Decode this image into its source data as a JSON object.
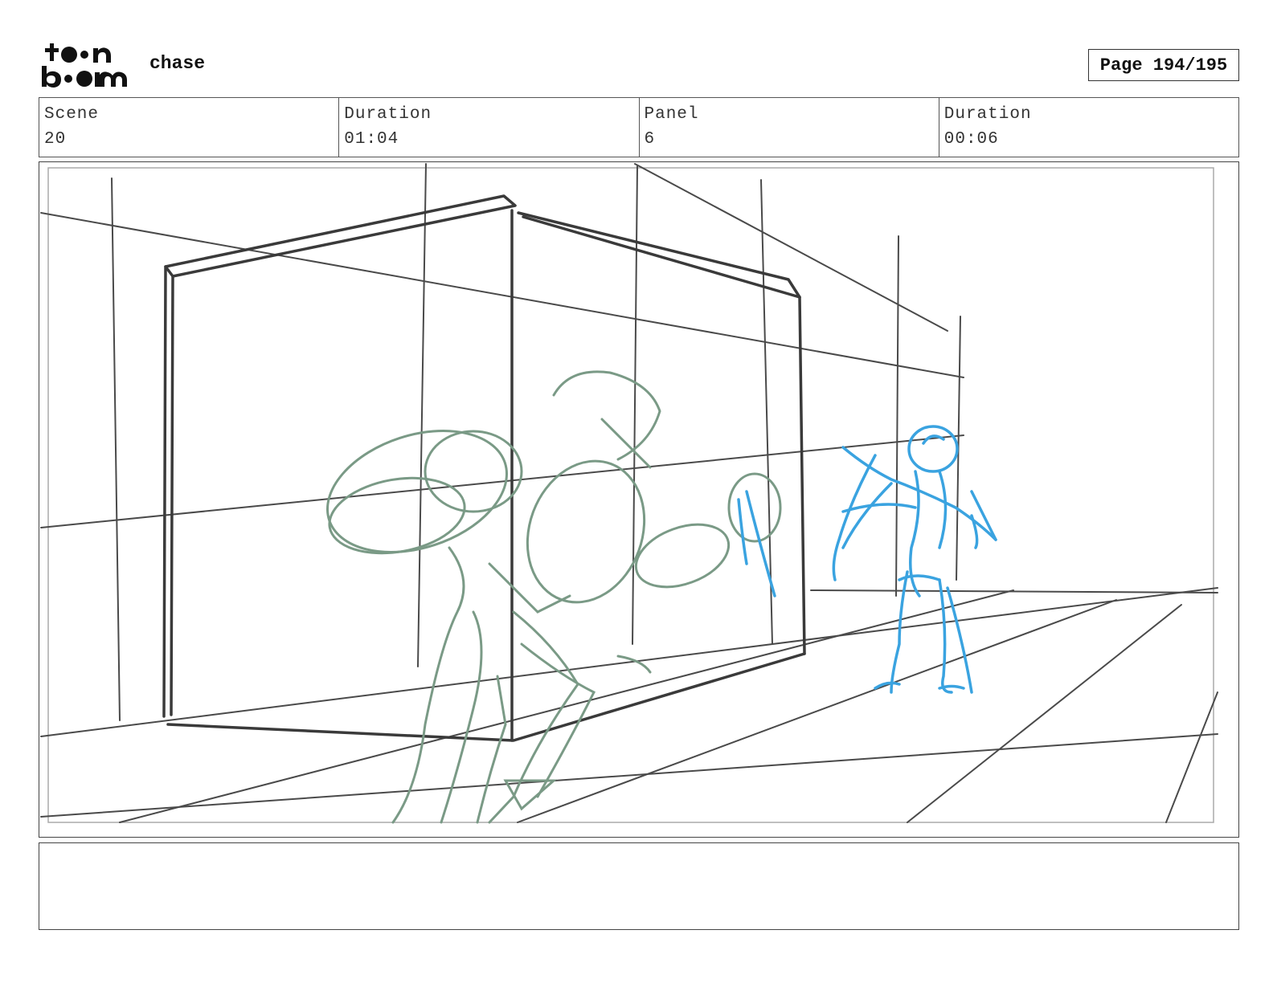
{
  "header": {
    "title": "chase",
    "page_label": "Page 194/195",
    "logo_alt": "toon boom"
  },
  "info": {
    "scene_label": "Scene",
    "scene_value": "20",
    "scene_duration_label": "Duration",
    "scene_duration_value": "01:04",
    "panel_label": "Panel",
    "panel_value": "6",
    "panel_duration_label": "Duration",
    "panel_duration_value": "00:06"
  },
  "notes": {
    "text": ""
  },
  "colors": {
    "background_lines": "#4a4a4a",
    "character_green": "#7a9a86",
    "character_blue": "#3aa3e0"
  }
}
